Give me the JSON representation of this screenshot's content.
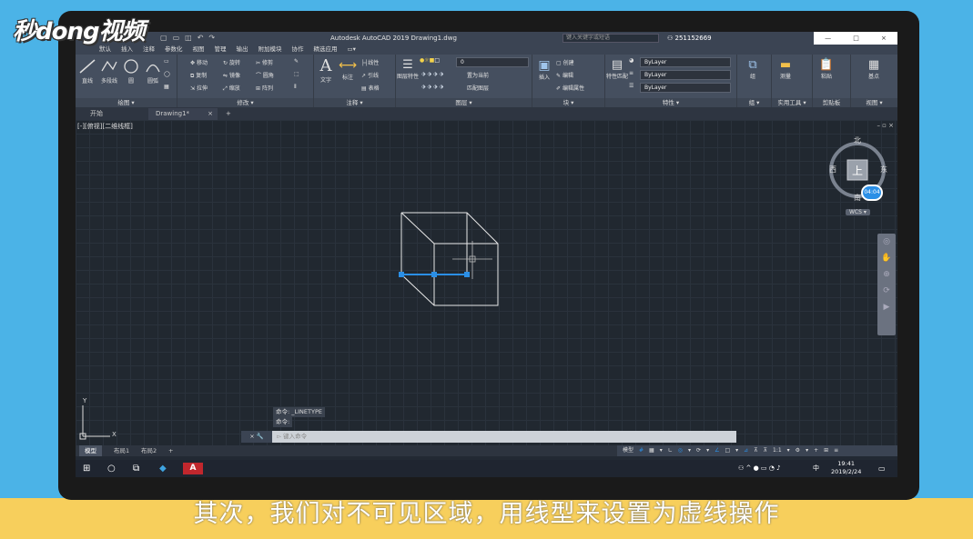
{
  "logo": {
    "text": "秒dong视频"
  },
  "titlebar": {
    "title": "Autodesk AutoCAD 2019    Drawing1.dwg",
    "search_placeholder": "键入关键字或短语",
    "user": "251152669",
    "win_min": "—",
    "win_max": "□",
    "win_close": "×"
  },
  "menubar": {
    "items": [
      "默认",
      "插入",
      "注释",
      "参数化",
      "视图",
      "管理",
      "输出",
      "附加模块",
      "协作",
      "精选应用",
      "▭▾"
    ]
  },
  "ribbon": {
    "draw": {
      "title": "绘图 ▾",
      "line": "直线",
      "polyline": "多段线",
      "circle": "圆",
      "arc": "圆弧"
    },
    "modify": {
      "title": "修改 ▾",
      "move": "移动",
      "rotate": "旋转",
      "trim": "修剪",
      "copy": "复制",
      "mirror": "镜像",
      "fillet": "圆角",
      "stretch": "拉伸",
      "scale": "缩放",
      "array": "阵列"
    },
    "annotation": {
      "title": "注释 ▾",
      "text": "文字",
      "dimension": "标注",
      "linear": "线性",
      "leader": "引线",
      "table": "表格"
    },
    "layers": {
      "title": "图层 ▾",
      "layer_props": "图层特性",
      "layer_value": "0",
      "set_current": "置为当前",
      "match_layer": "匹配图层"
    },
    "block": {
      "title": "块 ▾",
      "insert": "插入",
      "create": "创建",
      "edit": "编辑",
      "edit_attr": "编辑属性"
    },
    "properties": {
      "title": "特性 ▾",
      "match": "特性匹配",
      "color": "ByLayer",
      "linetype": "ByLayer",
      "lineweight": "ByLayer"
    },
    "groups": {
      "title": "组 ▾",
      "group": "组"
    },
    "utilities": {
      "title": "实用工具 ▾",
      "measure": "测量"
    },
    "clipboard": {
      "title": "剪贴板",
      "paste": "粘贴"
    },
    "view": {
      "title": "视图 ▾",
      "base": "基点"
    }
  },
  "doctabs": {
    "start": "开始",
    "drawing": "Drawing1*",
    "add": "+"
  },
  "viewport": {
    "label": "[-][俯视][二维线框]",
    "close": "– ▫ ×",
    "viewcube": {
      "n": "北",
      "s": "南",
      "e": "东",
      "w": "西",
      "face": "上",
      "wcs": "WCS ▾",
      "clock": "04:04"
    }
  },
  "ucs": {
    "x": "X",
    "y": "Y"
  },
  "command": {
    "history": [
      "命令:  _LINETYPE",
      "命令:"
    ],
    "placeholder": "键入命令"
  },
  "layout_tabs": [
    "模型",
    "布局1",
    "布局2",
    "+"
  ],
  "statusbar": {
    "items": [
      "模型",
      "#",
      "▦",
      "▾",
      "∟",
      "◎",
      "▾",
      "⟳",
      "▾",
      "∠",
      "□",
      "▾",
      "⊿",
      "⊼",
      "⊼",
      "1:1",
      "▾",
      "⚙",
      "▾",
      "+",
      "⊞",
      "≡"
    ]
  },
  "taskbar": {
    "time": "19:41",
    "date": "2019/2/24",
    "lang": "中"
  },
  "subtitle": {
    "text": "其次，我们对不可见区域，用线型来设置为虚线操作"
  },
  "colors": {
    "accent": "#2b8fe6",
    "background": "#4bb3e7",
    "bottom_bar": "#f7cf5c"
  }
}
